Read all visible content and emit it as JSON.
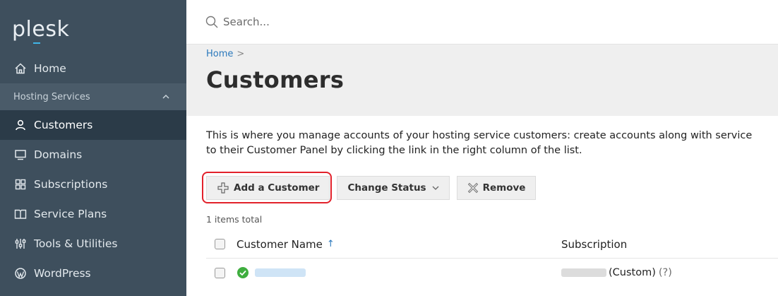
{
  "app": {
    "logo_text": "plesk",
    "accent_color": "#40b5e8"
  },
  "sidebar": {
    "home": {
      "label": "Home",
      "icon": "home-icon"
    },
    "group": {
      "label": "Hosting Services",
      "chevron": "^"
    },
    "items": [
      {
        "label": "Customers",
        "icon": "user-icon",
        "active": true
      },
      {
        "label": "Domains",
        "icon": "monitor-icon"
      },
      {
        "label": "Subscriptions",
        "icon": "grid-icon"
      },
      {
        "label": "Service Plans",
        "icon": "book-icon"
      },
      {
        "label": "Tools & Utilities",
        "icon": "sliders-icon"
      },
      {
        "label": "WordPress",
        "icon": "wordpress-icon"
      }
    ]
  },
  "search": {
    "placeholder": "Search..."
  },
  "breadcrumb": {
    "home": "Home",
    "separator": ">"
  },
  "page": {
    "title": "Customers",
    "description_line1": "This is where you manage accounts of your hosting service customers: create accounts along with service",
    "description_line2": "to their Customer Panel by clicking the link in the right column of the list."
  },
  "toolbar": {
    "add_label": "Add a Customer",
    "change_status_label": "Change Status",
    "remove_label": "Remove"
  },
  "list": {
    "items_total": "1 items total",
    "columns": {
      "name": "Customer Name",
      "sort_indicator": "↑",
      "subscription": "Subscription"
    },
    "rows": [
      {
        "status": "active",
        "subscription_suffix": "(Custom)",
        "help": "(?)"
      }
    ]
  },
  "colors": {
    "sidebar_bg": "#3e4f5d",
    "active_bg": "#2b3b48",
    "link": "#2a78bc",
    "highlight": "#e2212b",
    "status_ok": "#3fae3f"
  }
}
